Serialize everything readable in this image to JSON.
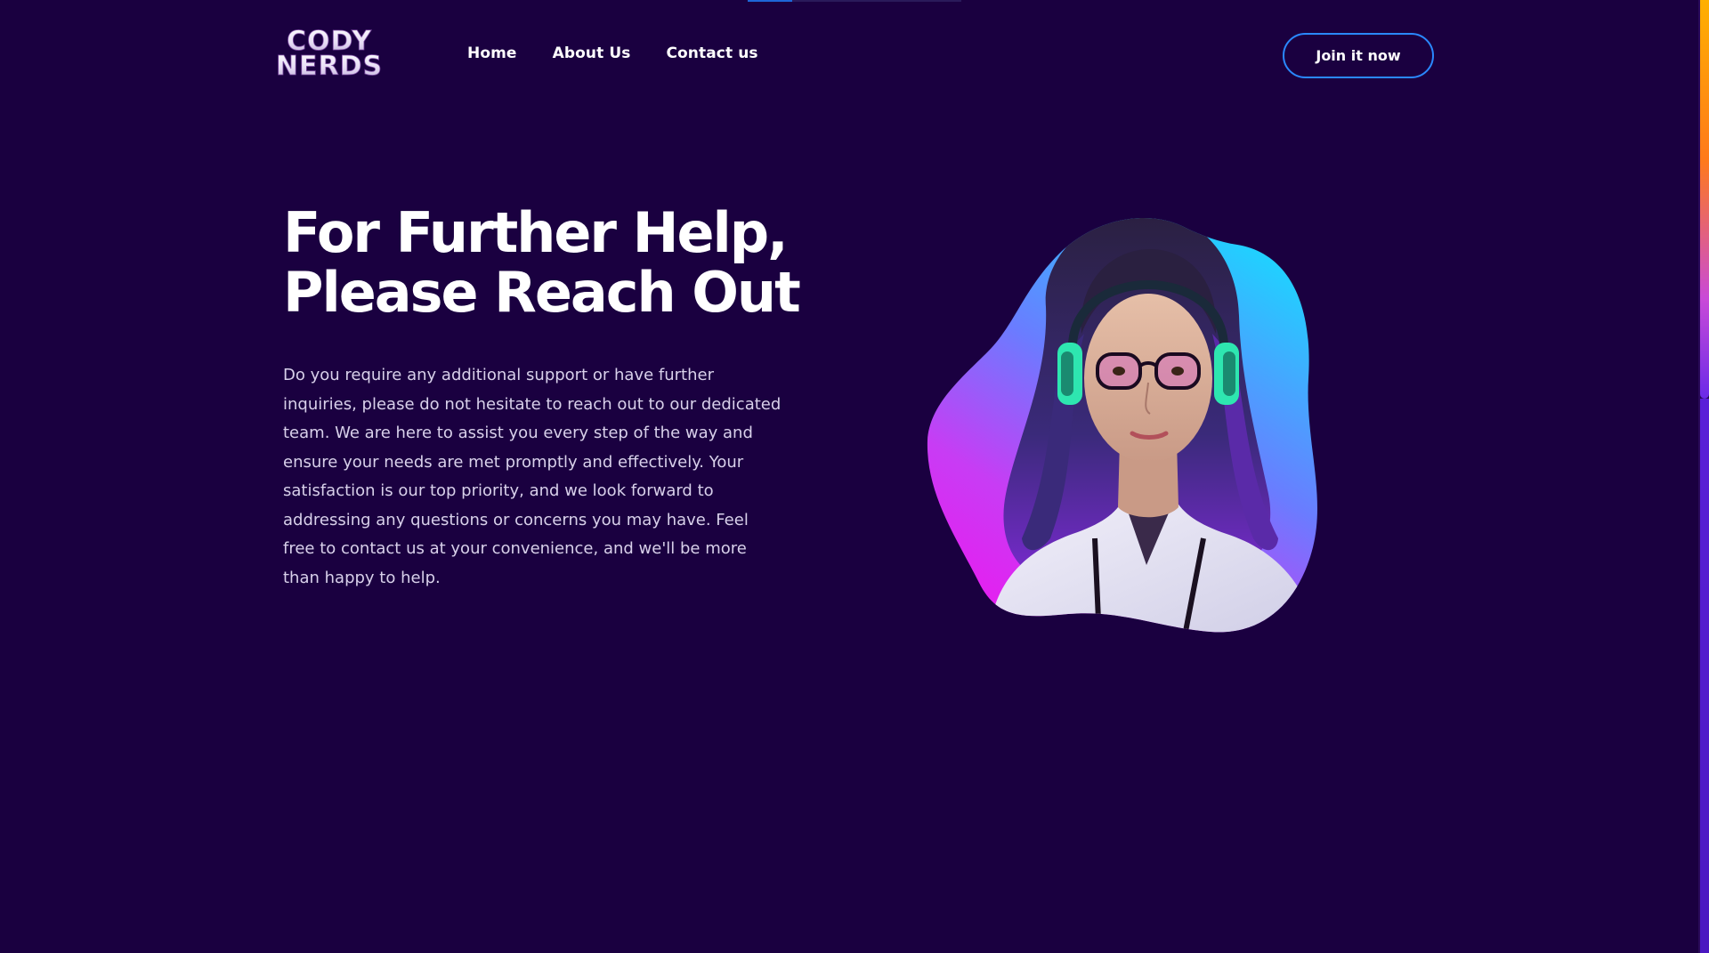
{
  "brand": {
    "logo_line1": "CODY",
    "logo_line2": "NERDS"
  },
  "nav": {
    "items": [
      {
        "label": "Home"
      },
      {
        "label": "About Us"
      },
      {
        "label": "Contact us"
      }
    ]
  },
  "header": {
    "cta_label": "Join it now"
  },
  "hero": {
    "title_line1": "For Further Help,",
    "title_line2": "Please Reach Out",
    "body": "Do you require any additional support or have further inquiries, please do not hesitate to reach out to our dedicated team. We are here to assist you every step of the way and ensure your needs are met promptly and effectively. Your satisfaction is our top priority, and we look forward to addressing any questions or concerns you may have. Feel free to contact us at your convenience, and we'll be more than happy to help."
  },
  "colors": {
    "background": "#1a0040",
    "accent_blue": "#2a88ff",
    "blob_cyan": "#22d3ff",
    "blob_magenta": "#e020f0",
    "headphone_teal": "#2ee6b0"
  },
  "icons": {
    "hero_illustration": "support-agent-illustration"
  }
}
